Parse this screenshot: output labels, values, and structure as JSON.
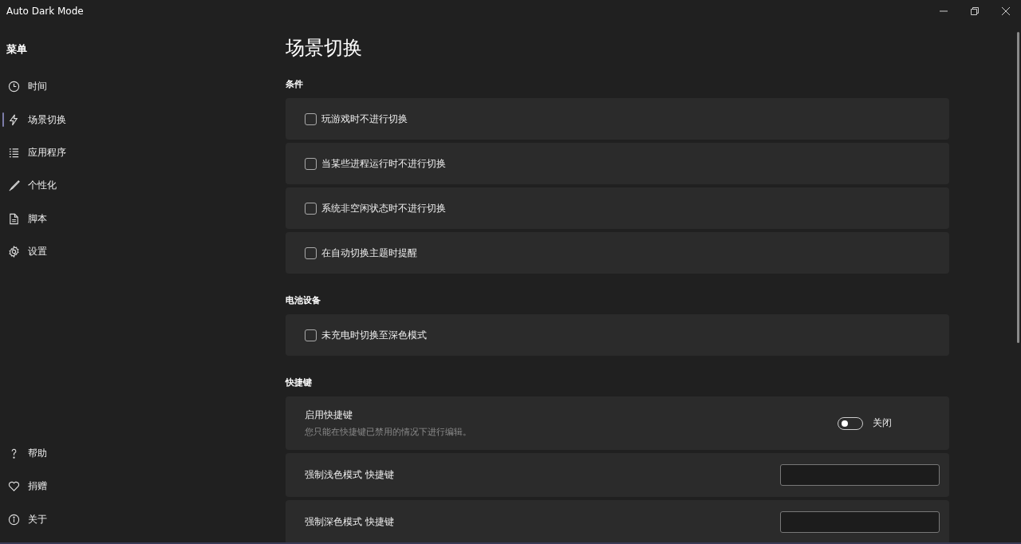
{
  "window": {
    "title": "Auto Dark Mode"
  },
  "sidebar": {
    "heading": "菜单",
    "items": [
      {
        "label": "时间",
        "selected": false
      },
      {
        "label": "场景切换",
        "selected": true
      },
      {
        "label": "应用程序",
        "selected": false
      },
      {
        "label": "个性化",
        "selected": false
      },
      {
        "label": "脚本",
        "selected": false
      },
      {
        "label": "设置",
        "selected": false
      }
    ],
    "footer_items": [
      {
        "label": "帮助",
        "selected": false
      },
      {
        "label": "捐赠",
        "selected": false
      },
      {
        "label": "关于",
        "selected": false
      }
    ]
  },
  "page": {
    "title": "场景切换",
    "sections": [
      {
        "heading": "条件",
        "cards": [
          {
            "kind": "checkbox",
            "label": "玩游戏时不进行切换",
            "checked": false
          },
          {
            "kind": "checkbox",
            "label": "当某些进程运行时不进行切换",
            "checked": false
          },
          {
            "kind": "checkbox",
            "label": "系统非空闲状态时不进行切换",
            "checked": false
          },
          {
            "kind": "checkbox",
            "label": "在自动切换主题时提醒",
            "checked": false
          }
        ]
      },
      {
        "heading": "电池设备",
        "cards": [
          {
            "kind": "checkbox",
            "label": "未充电时切换至深色模式",
            "checked": false
          }
        ]
      },
      {
        "heading": "快捷键",
        "cards": [
          {
            "kind": "toggle",
            "label": "启用快捷键",
            "description": "您只能在快捷键已禁用的情况下进行编辑。",
            "on": false,
            "state_text": "关闭"
          },
          {
            "kind": "hotkey",
            "label": "强制浅色模式 快捷键"
          },
          {
            "kind": "hotkey",
            "label": "强制深色模式 快捷键"
          }
        ]
      }
    ]
  }
}
